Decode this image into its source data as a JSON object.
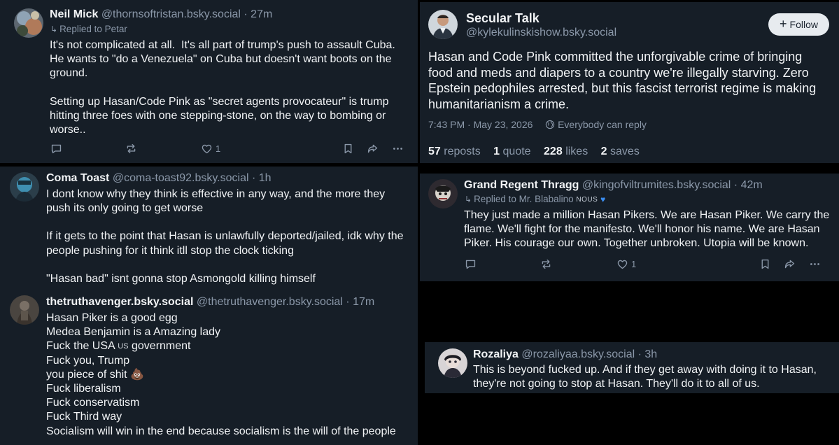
{
  "neil": {
    "name": "Neil Mick",
    "handle": "@thornsoftristan.bsky.social · 27m",
    "reply_to": "Replied to Petar",
    "text": [
      "It's not complicated at all.  It's all part of trump's push to assault Cuba.",
      "He wants to \"do a Venezuela\" on Cuba but doesn't want boots on the",
      "ground.",
      "",
      "Setting up Hasan/Code Pink as \"secret agents provocateur\" is trump",
      "hitting three foes with one stepping-stone, on the way to bombing or",
      "worse.."
    ],
    "likes": "1"
  },
  "coma": {
    "name": "Coma Toast",
    "handle": "@coma-toast92.bsky.social · 1h",
    "text": [
      "I dont know why they think is effective in any way, and the more they",
      "push its only going to get worse",
      "",
      "If it gets to the point that Hasan is unlawfully deported/jailed, idk why the",
      "people pushing for it think itll stop the clock ticking",
      "",
      "\"Hasan bad\" isnt gonna stop Asmongold killing himself"
    ]
  },
  "truth": {
    "name": "thetruthavenger.bsky.social",
    "handle": "@thetruthavenger.bsky.social · 17m",
    "lines": {
      "l1": "Hasan Piker is a good egg",
      "l2": "Medea Benjamin is a Amazing lady",
      "l3a": "Fuck the USA ",
      "l3flag": "US",
      "l3b": " government",
      "l4": "Fuck you, Trump",
      "l5": "you piece of shit ",
      "l5emoji": "💩",
      "l6": "Fuck liberalism",
      "l7": "Fuck conservatism",
      "l8": "Fuck Third way",
      "l9": "Socialism will win in the end because socialism is the will of the people"
    }
  },
  "secular": {
    "name": "Secular Talk",
    "handle": "@kylekulinskishow.bsky.social",
    "follow_label": "Follow",
    "text": [
      "Hasan and Code Pink committed the unforgivable crime of bringing",
      "food and meds and diapers to a country we're illegally starving. Zero",
      "Epstein pedophiles arrested, but this fascist terrorist regime is making",
      "humanitarianism a crime."
    ],
    "timestamp": "7:43 PM · May 23, 2026",
    "reply_setting": "Everybody can reply",
    "reposts_n": "57",
    "reposts_l": "reposts",
    "quotes_n": "1",
    "quotes_l": "quote",
    "likes_n": "228",
    "likes_l": "likes",
    "saves_n": "2",
    "saves_l": "saves"
  },
  "thragg": {
    "name": "Grand Regent Thragg",
    "handle": "@kingofviltrumites.bsky.social · 42m",
    "reply_to": "Replied to Mr. Blabalino",
    "badge": "NOUS",
    "text": [
      "They just made a million Hasan Pikers. We are Hasan Piker. We carry the",
      "flame. We'll fight for the manifesto. We'll honor his name. We are Hasan",
      "Piker. His courage our own. Together unbroken. Utopia will be known."
    ],
    "likes": "1"
  },
  "rozaliya": {
    "name": "Rozaliya",
    "handle": "@rozaliyaa.bsky.social · 3h",
    "text": [
      "This is beyond fucked up. And if they get away with doing it to Hasan,",
      "they're not going to stop at Hasan. They'll do it to all of us."
    ]
  },
  "colors": {
    "panel": "#161e27",
    "text": "#f1f3f5",
    "muted": "#8b98a9",
    "background": "#000000"
  },
  "icons": [
    "reply-icon",
    "repost-icon",
    "like-icon",
    "bookmark-icon",
    "share-icon",
    "more-icon",
    "globe-icon"
  ]
}
